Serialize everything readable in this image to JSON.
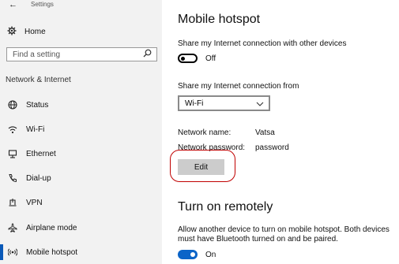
{
  "window": {
    "title": "Settings"
  },
  "sidebar": {
    "home_label": "Home",
    "search_placeholder": "Find a setting",
    "section_label": "Network & Internet",
    "items": [
      {
        "label": "Status",
        "icon": "globe-icon"
      },
      {
        "label": "Wi-Fi",
        "icon": "wifi-icon"
      },
      {
        "label": "Ethernet",
        "icon": "ethernet-icon"
      },
      {
        "label": "Dial-up",
        "icon": "phone-icon"
      },
      {
        "label": "VPN",
        "icon": "vpn-icon"
      },
      {
        "label": "Airplane mode",
        "icon": "airplane-icon"
      },
      {
        "label": "Mobile hotspot",
        "icon": "hotspot-icon",
        "selected": true
      }
    ]
  },
  "main": {
    "title": "Mobile hotspot",
    "share_label": "Share my Internet connection with other devices",
    "share_toggle_state": "Off",
    "share_from_label": "Share my Internet connection from",
    "share_from_value": "Wi-Fi",
    "network_name_label": "Network name:",
    "network_name_value": "Vatsa",
    "network_password_label": "Network password:",
    "network_password_value": "password",
    "edit_label": "Edit",
    "remote_title": "Turn on remotely",
    "remote_desc_line1": "Allow another device to turn on mobile hotspot. Both devices",
    "remote_desc_line2": "must have Bluetooth turned on and be paired.",
    "remote_toggle_state": "On"
  },
  "colors": {
    "accent": "#0b64c8",
    "sidebar_bg": "#f2f2f2",
    "highlight": "#c00000"
  }
}
